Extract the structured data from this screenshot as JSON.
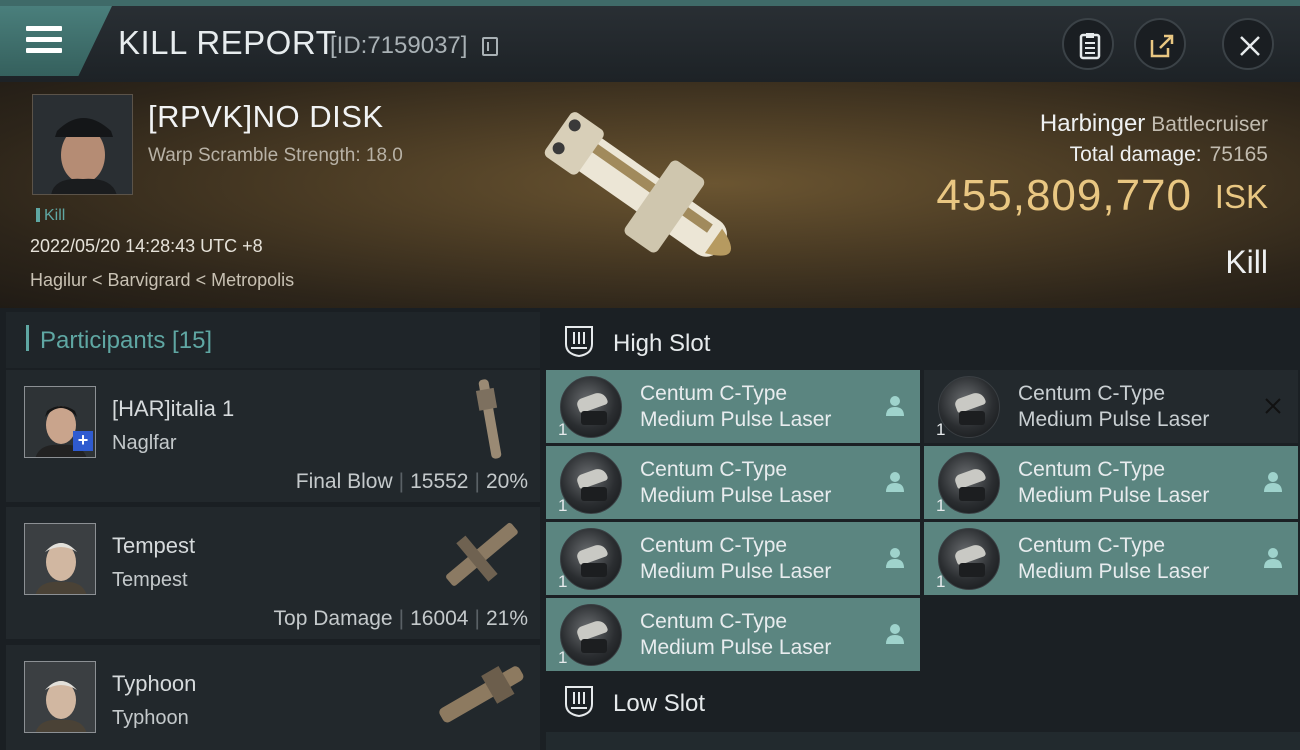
{
  "header": {
    "title": "KILL REPORT",
    "report_id": "[ID:7159037]",
    "icons": [
      "menu-icon",
      "copy-icon",
      "clipboard-icon",
      "share-icon",
      "close-icon"
    ]
  },
  "victim": {
    "name": "[RPVK]NO DISK",
    "warp_scramble": "Warp Scramble Strength: 18.0",
    "kill_tag": "Kill",
    "datetime": "2022/05/20 14:28:43 UTC +8",
    "location": "Hagilur < Barvigrard < Metropolis",
    "ship": "Harbinger",
    "ship_class": "Battlecruiser",
    "total_damage_label": "Total damage:",
    "total_damage_value": "75165",
    "isk_value": "455,809,770",
    "isk_unit": "ISK",
    "result": "Kill"
  },
  "participants": {
    "title": "Participants [15]",
    "items": [
      {
        "name": "[HAR]italia 1",
        "ship": "Naglfar",
        "label": "Final Blow",
        "damage": "15552",
        "percent": "20%"
      },
      {
        "name": "Tempest",
        "ship": "Tempest",
        "label": "Top Damage",
        "damage": "16004",
        "percent": "21%"
      },
      {
        "name": "Typhoon",
        "ship": "Typhoon",
        "label": "",
        "damage": "",
        "percent": ""
      }
    ]
  },
  "slots": {
    "high_title": "High Slot",
    "low_title": "Low Slot",
    "modules": [
      {
        "qty": "1",
        "line1": "Centum C-Type",
        "line2": "Medium Pulse Laser",
        "status": "person-icon"
      },
      {
        "qty": "1",
        "line1": "Centum C-Type",
        "line2": "Medium Pulse Laser",
        "status": "cross-icon"
      },
      {
        "qty": "1",
        "line1": "Centum C-Type",
        "line2": "Medium Pulse Laser",
        "status": "person-icon"
      },
      {
        "qty": "1",
        "line1": "Centum C-Type",
        "line2": "Medium Pulse Laser",
        "status": "person-icon"
      },
      {
        "qty": "1",
        "line1": "Centum C-Type",
        "line2": "Medium Pulse Laser",
        "status": "person-icon"
      },
      {
        "qty": "1",
        "line1": "Centum C-Type",
        "line2": "Medium Pulse Laser",
        "status": "person-icon"
      },
      {
        "qty": "1",
        "line1": "Centum C-Type",
        "line2": "Medium Pulse Laser",
        "status": "person-icon"
      }
    ]
  },
  "colors": {
    "accent_teal": "#5fa7a3",
    "isk_gold": "#e9c782",
    "fitted_module": "#5b8580",
    "dropped_module": "#23292d"
  }
}
